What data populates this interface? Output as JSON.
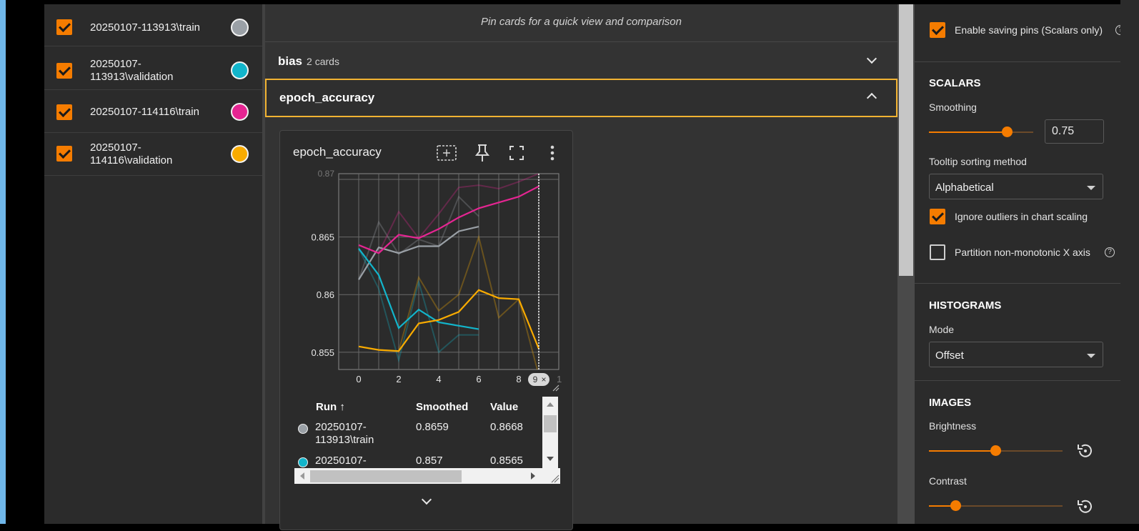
{
  "runs": [
    {
      "label": "20250107-113913\\train",
      "checked": true,
      "color": "#9aa0a6"
    },
    {
      "label": "20250107-113913\\validation",
      "checked": true,
      "color": "#12b5cb"
    },
    {
      "label": "20250107-114116\\train",
      "checked": true,
      "color": "#e52592"
    },
    {
      "label": "20250107-114116\\validation",
      "checked": true,
      "color": "#f9ab00"
    }
  ],
  "main": {
    "pin_hint": "Pin cards for a quick view and comparison",
    "groups": [
      {
        "title": "bias",
        "count": "2 cards",
        "expanded": false
      },
      {
        "title": "epoch_accuracy",
        "count": "",
        "expanded": true
      }
    ]
  },
  "card": {
    "title": "epoch_accuracy",
    "tools": [
      "fit-domain-icon",
      "pin-icon",
      "fullscreen-icon",
      "more-vert-icon"
    ],
    "x_ticks": [
      "0",
      "2",
      "4",
      "6",
      "8"
    ],
    "x_cut_tick": "1",
    "y_ticks": [
      "0.865",
      "0.86",
      "0.855"
    ],
    "y_top_partial": "0.87",
    "cursor_step": "9",
    "cursor_close": "×",
    "table": {
      "headers": {
        "run": "Run ↑",
        "smoothed": "Smoothed",
        "value": "Value"
      },
      "rows": [
        {
          "run": "20250107-113913\\train",
          "smoothed": "0.8659",
          "value": "0.8668",
          "color": "#9aa0a6"
        },
        {
          "run": "20250107-",
          "smoothed": "0.857",
          "value": "0.8565",
          "color": "#12b5cb"
        }
      ]
    }
  },
  "chart_data": {
    "type": "line",
    "title": "epoch_accuracy",
    "xlabel": "",
    "ylabel": "",
    "xlim": [
      -1,
      10
    ],
    "ylim": [
      0.8535,
      0.8705
    ],
    "grid": true,
    "cursor_x": 9,
    "series": [
      {
        "name": "20250107-113913\\train",
        "color": "#9aa0a6",
        "x": [
          0,
          1,
          2,
          3,
          4,
          5,
          6
        ],
        "smoothed": [
          0.8613,
          0.8641,
          0.8636,
          0.8642,
          0.8642,
          0.8655,
          0.8659
        ],
        "raw": [
          0.8613,
          0.8663,
          0.8635,
          0.8648,
          0.8642,
          0.8685,
          0.8668
        ]
      },
      {
        "name": "20250107-113913\\validation",
        "color": "#12b5cb",
        "x": [
          0,
          1,
          2,
          3,
          4,
          5,
          6
        ],
        "smoothed": [
          0.864,
          0.8617,
          0.8571,
          0.8587,
          0.8576,
          0.8573,
          0.857
        ],
        "raw": [
          0.864,
          0.8605,
          0.8543,
          0.8611,
          0.855,
          0.8565,
          0.8565
        ]
      },
      {
        "name": "20250107-114116\\train",
        "color": "#e52592",
        "x": [
          0,
          1,
          2,
          3,
          4,
          5,
          6,
          7,
          8,
          9
        ],
        "smoothed": [
          0.8643,
          0.8636,
          0.8652,
          0.8649,
          0.8657,
          0.8667,
          0.8675,
          0.868,
          0.8685,
          0.8694
        ],
        "raw": [
          0.8643,
          0.8636,
          0.8672,
          0.8649,
          0.867,
          0.8693,
          0.8695,
          0.8692,
          0.8698,
          0.8705
        ]
      },
      {
        "name": "20250107-114116\\validation",
        "color": "#f9ab00",
        "x": [
          0,
          1,
          2,
          3,
          4,
          5,
          6,
          7,
          8,
          9
        ],
        "smoothed": [
          0.8555,
          0.8552,
          0.8551,
          0.8575,
          0.8578,
          0.8585,
          0.8604,
          0.8597,
          0.8596,
          0.8553
        ],
        "raw": [
          0.8555,
          0.8552,
          0.8551,
          0.8615,
          0.8586,
          0.86,
          0.865,
          0.858,
          0.8596,
          0.853
        ]
      }
    ]
  },
  "settings": {
    "enable_pins_label": "Enable saving pins (Scalars only)",
    "scalars_title": "SCALARS",
    "smoothing_label": "Smoothing",
    "smoothing_value": "0.75",
    "smoothing_fraction": 0.75,
    "tooltip_label": "Tooltip sorting method",
    "tooltip_value": "Alphabetical",
    "ignore_outliers_label": "Ignore outliers in chart scaling",
    "ignore_outliers": true,
    "partition_label": "Partition non-monotonic X axis",
    "partition": false,
    "histograms_title": "HISTOGRAMS",
    "mode_label": "Mode",
    "mode_value": "Offset",
    "images_title": "IMAGES",
    "brightness_label": "Brightness",
    "brightness_fraction": 0.5,
    "contrast_label": "Contrast",
    "contrast_fraction": 0.2
  }
}
